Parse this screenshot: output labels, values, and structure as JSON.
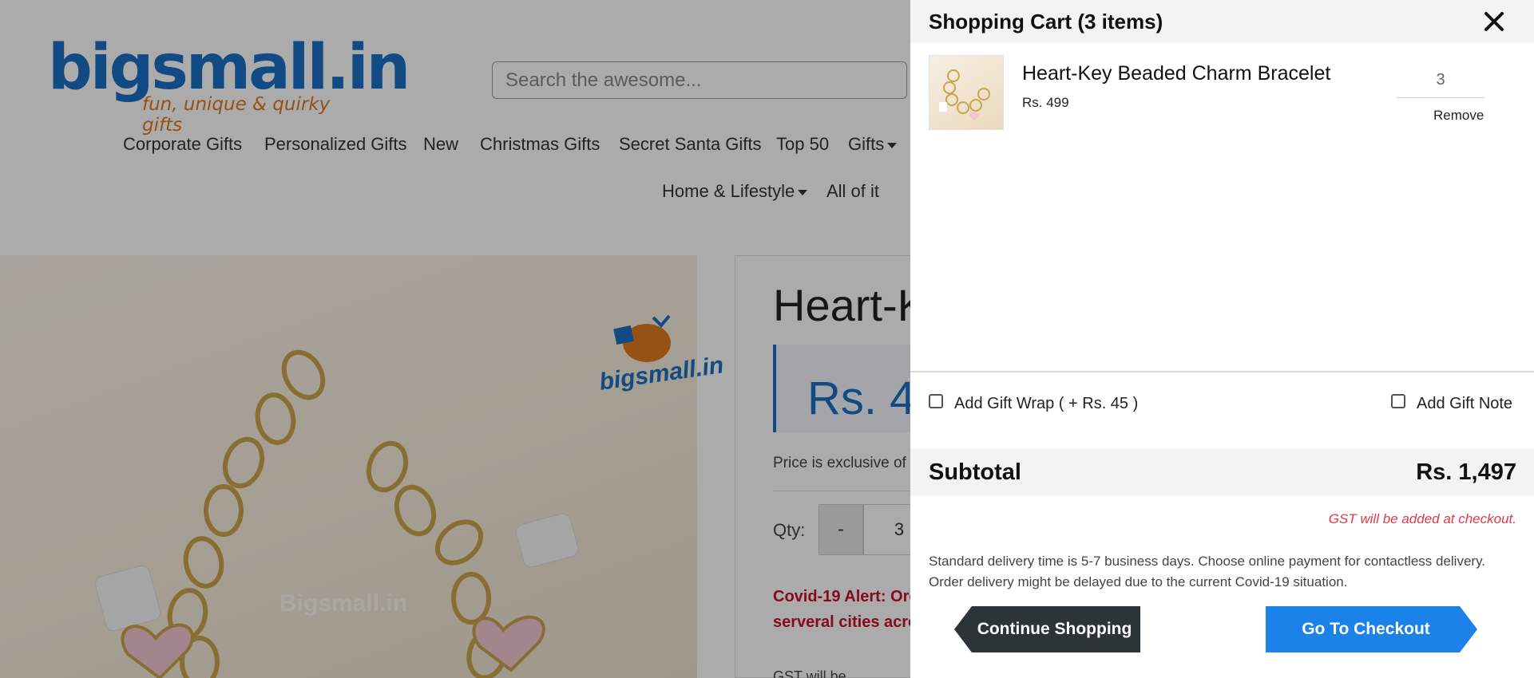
{
  "site": {
    "logo_main": "bigsmall.in",
    "logo_tagline": "fun, unique & quirky gifts",
    "search_placeholder": "Search the awesome...",
    "nav": [
      {
        "label": "Corporate Gifts"
      },
      {
        "label": "Personalized Gifts"
      },
      {
        "label": "New"
      },
      {
        "label": "Christmas Gifts"
      },
      {
        "label": "Secret Santa Gifts"
      },
      {
        "label": "Top 50"
      },
      {
        "label": "Gifts",
        "dropdown": true
      },
      {
        "label": "Home & Lifestyle",
        "dropdown": true
      },
      {
        "label": "All of it"
      }
    ]
  },
  "product": {
    "title_visible": "Heart-K",
    "price_visible": "Rs. 4",
    "price_note_visible": "Price is exclusive of",
    "qty_label": "Qty:",
    "qty_minus": "-",
    "qty_value": "3",
    "covid_line1": "Covid-19 Alert: Ord",
    "covid_line2": "serveral cities acros",
    "image_logo": "bigsmall.in",
    "image_watermark": "Bigsmall.in",
    "gst_peek": "GST will be"
  },
  "cart": {
    "title": "Shopping Cart (3 items)",
    "close_icon": "close-icon",
    "items": [
      {
        "name": "Heart-Key Beaded Charm Bracelet",
        "price": "Rs. 499",
        "qty": "3",
        "remove_label": "Remove"
      }
    ],
    "gift_wrap_label": "Add Gift Wrap ( + Rs. 45 )",
    "gift_note_label": "Add Gift Note",
    "subtotal_label": "Subtotal",
    "subtotal_value": "Rs. 1,497",
    "gst_note": "GST will be added at checkout.",
    "delivery_line1": "Standard delivery time is 5-7 business days. Choose online payment for contactless delivery.",
    "delivery_line2": "Order delivery might be delayed due to the current Covid-19 situation.",
    "continue_label": "Continue Shopping",
    "checkout_label": "Go To Checkout"
  },
  "colors": {
    "brand_blue": "#1c6fc4",
    "brand_orange": "#e07a1f",
    "checkout_blue": "#1a82e8",
    "continue_dark": "#2d3438",
    "gst_red": "#e0394a",
    "covid_red": "#c8102e"
  }
}
